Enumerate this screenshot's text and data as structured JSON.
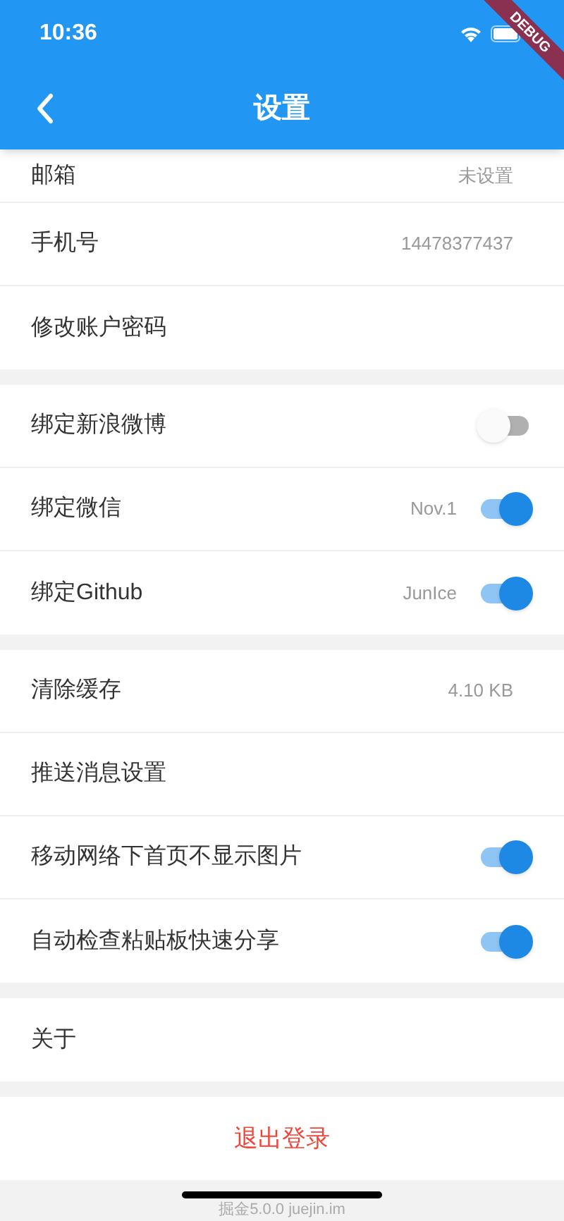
{
  "status_bar": {
    "time": "10:36"
  },
  "debug_banner": "DEBUG",
  "app_bar": {
    "title": "设置"
  },
  "groups": [
    {
      "rows": [
        {
          "kind": "value",
          "label": "邮箱",
          "value": "未设置",
          "clipped": true
        },
        {
          "kind": "value",
          "label": "手机号",
          "value": "14478377437"
        },
        {
          "kind": "plain",
          "label": "修改账户密码"
        }
      ]
    },
    {
      "rows": [
        {
          "kind": "switch",
          "label": "绑定新浪微博",
          "on": false
        },
        {
          "kind": "switch",
          "label": "绑定微信",
          "value": "Nov.1",
          "on": true
        },
        {
          "kind": "switch",
          "label": "绑定Github",
          "value": "JunIce",
          "on": true
        }
      ]
    },
    {
      "rows": [
        {
          "kind": "value",
          "label": "清除缓存",
          "value": "4.10 KB"
        },
        {
          "kind": "plain",
          "label": "推送消息设置"
        },
        {
          "kind": "switch",
          "label": "移动网络下首页不显示图片",
          "on": true
        },
        {
          "kind": "switch",
          "label": "自动检查粘贴板快速分享",
          "on": true
        }
      ]
    },
    {
      "rows": [
        {
          "kind": "plain",
          "label": "关于"
        }
      ]
    },
    {
      "rows": [
        {
          "kind": "logout",
          "label": "退出登录"
        }
      ]
    }
  ],
  "footer": "掘金5.0.0 juejin.im"
}
